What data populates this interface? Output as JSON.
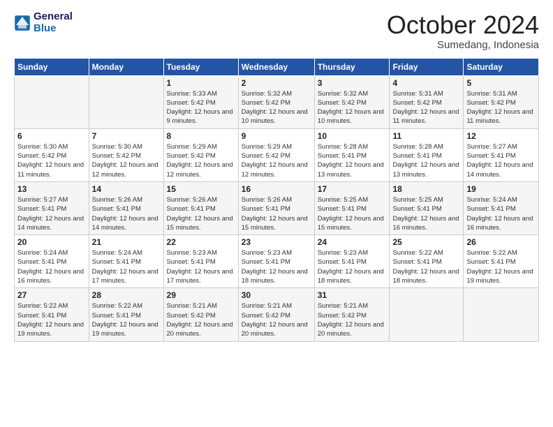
{
  "logo": {
    "line1": "General",
    "line2": "Blue"
  },
  "title": "October 2024",
  "subtitle": "Sumedang, Indonesia",
  "days_of_week": [
    "Sunday",
    "Monday",
    "Tuesday",
    "Wednesday",
    "Thursday",
    "Friday",
    "Saturday"
  ],
  "weeks": [
    [
      {
        "day": "",
        "info": ""
      },
      {
        "day": "",
        "info": ""
      },
      {
        "day": "1",
        "info": "Sunrise: 5:33 AM\nSunset: 5:42 PM\nDaylight: 12 hours and 9 minutes."
      },
      {
        "day": "2",
        "info": "Sunrise: 5:32 AM\nSunset: 5:42 PM\nDaylight: 12 hours and 10 minutes."
      },
      {
        "day": "3",
        "info": "Sunrise: 5:32 AM\nSunset: 5:42 PM\nDaylight: 12 hours and 10 minutes."
      },
      {
        "day": "4",
        "info": "Sunrise: 5:31 AM\nSunset: 5:42 PM\nDaylight: 12 hours and 11 minutes."
      },
      {
        "day": "5",
        "info": "Sunrise: 5:31 AM\nSunset: 5:42 PM\nDaylight: 12 hours and 11 minutes."
      }
    ],
    [
      {
        "day": "6",
        "info": "Sunrise: 5:30 AM\nSunset: 5:42 PM\nDaylight: 12 hours and 11 minutes."
      },
      {
        "day": "7",
        "info": "Sunrise: 5:30 AM\nSunset: 5:42 PM\nDaylight: 12 hours and 12 minutes."
      },
      {
        "day": "8",
        "info": "Sunrise: 5:29 AM\nSunset: 5:42 PM\nDaylight: 12 hours and 12 minutes."
      },
      {
        "day": "9",
        "info": "Sunrise: 5:29 AM\nSunset: 5:42 PM\nDaylight: 12 hours and 12 minutes."
      },
      {
        "day": "10",
        "info": "Sunrise: 5:28 AM\nSunset: 5:41 PM\nDaylight: 12 hours and 13 minutes."
      },
      {
        "day": "11",
        "info": "Sunrise: 5:28 AM\nSunset: 5:41 PM\nDaylight: 12 hours and 13 minutes."
      },
      {
        "day": "12",
        "info": "Sunrise: 5:27 AM\nSunset: 5:41 PM\nDaylight: 12 hours and 14 minutes."
      }
    ],
    [
      {
        "day": "13",
        "info": "Sunrise: 5:27 AM\nSunset: 5:41 PM\nDaylight: 12 hours and 14 minutes."
      },
      {
        "day": "14",
        "info": "Sunrise: 5:26 AM\nSunset: 5:41 PM\nDaylight: 12 hours and 14 minutes."
      },
      {
        "day": "15",
        "info": "Sunrise: 5:26 AM\nSunset: 5:41 PM\nDaylight: 12 hours and 15 minutes."
      },
      {
        "day": "16",
        "info": "Sunrise: 5:26 AM\nSunset: 5:41 PM\nDaylight: 12 hours and 15 minutes."
      },
      {
        "day": "17",
        "info": "Sunrise: 5:25 AM\nSunset: 5:41 PM\nDaylight: 12 hours and 15 minutes."
      },
      {
        "day": "18",
        "info": "Sunrise: 5:25 AM\nSunset: 5:41 PM\nDaylight: 12 hours and 16 minutes."
      },
      {
        "day": "19",
        "info": "Sunrise: 5:24 AM\nSunset: 5:41 PM\nDaylight: 12 hours and 16 minutes."
      }
    ],
    [
      {
        "day": "20",
        "info": "Sunrise: 5:24 AM\nSunset: 5:41 PM\nDaylight: 12 hours and 16 minutes."
      },
      {
        "day": "21",
        "info": "Sunrise: 5:24 AM\nSunset: 5:41 PM\nDaylight: 12 hours and 17 minutes."
      },
      {
        "day": "22",
        "info": "Sunrise: 5:23 AM\nSunset: 5:41 PM\nDaylight: 12 hours and 17 minutes."
      },
      {
        "day": "23",
        "info": "Sunrise: 5:23 AM\nSunset: 5:41 PM\nDaylight: 12 hours and 18 minutes."
      },
      {
        "day": "24",
        "info": "Sunrise: 5:23 AM\nSunset: 5:41 PM\nDaylight: 12 hours and 18 minutes."
      },
      {
        "day": "25",
        "info": "Sunrise: 5:22 AM\nSunset: 5:41 PM\nDaylight: 12 hours and 18 minutes."
      },
      {
        "day": "26",
        "info": "Sunrise: 5:22 AM\nSunset: 5:41 PM\nDaylight: 12 hours and 19 minutes."
      }
    ],
    [
      {
        "day": "27",
        "info": "Sunrise: 5:22 AM\nSunset: 5:41 PM\nDaylight: 12 hours and 19 minutes."
      },
      {
        "day": "28",
        "info": "Sunrise: 5:22 AM\nSunset: 5:41 PM\nDaylight: 12 hours and 19 minutes."
      },
      {
        "day": "29",
        "info": "Sunrise: 5:21 AM\nSunset: 5:42 PM\nDaylight: 12 hours and 20 minutes."
      },
      {
        "day": "30",
        "info": "Sunrise: 5:21 AM\nSunset: 5:42 PM\nDaylight: 12 hours and 20 minutes."
      },
      {
        "day": "31",
        "info": "Sunrise: 5:21 AM\nSunset: 5:42 PM\nDaylight: 12 hours and 20 minutes."
      },
      {
        "day": "",
        "info": ""
      },
      {
        "day": "",
        "info": ""
      }
    ]
  ]
}
